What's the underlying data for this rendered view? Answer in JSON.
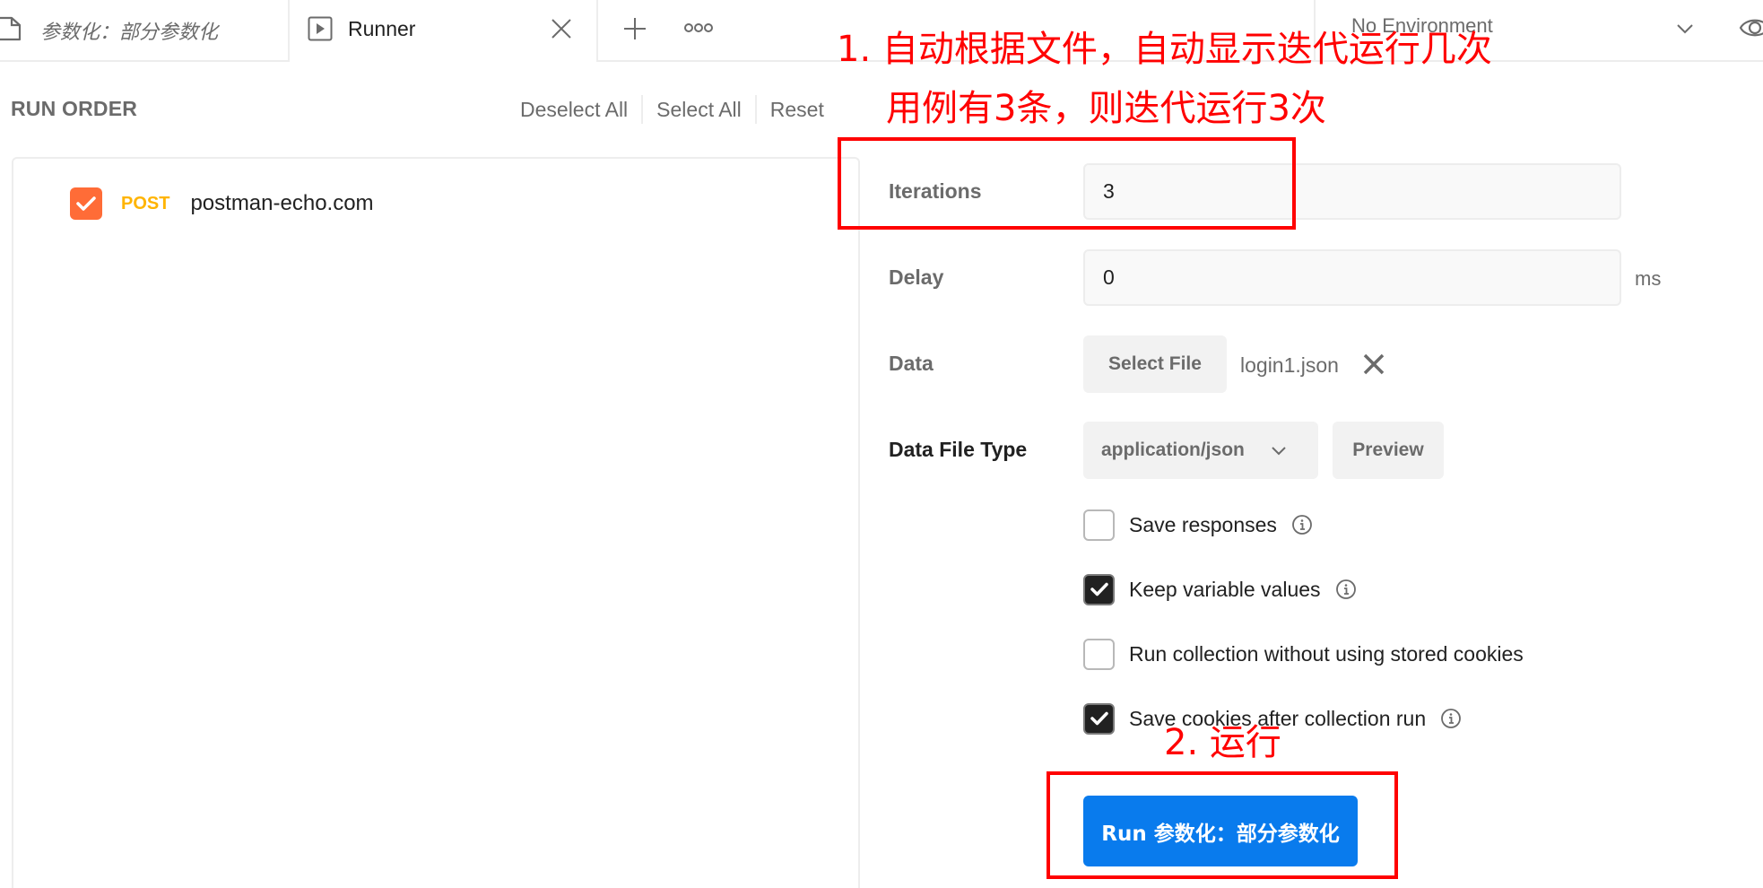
{
  "tabs": [
    {
      "label": "参数化：部分参数化",
      "icon": "collection-doc-icon",
      "active": false
    },
    {
      "label": "Runner",
      "icon": "runner-play-icon",
      "active": true
    }
  ],
  "tab_actions": {
    "new_tab_icon": "plus-icon",
    "more_icon": "more-options-icon"
  },
  "environment": {
    "selected": "No Environment",
    "chevron_icon": "chevron-down-icon",
    "quick_look_icon": "eye-icon"
  },
  "run_order": {
    "title": "RUN ORDER",
    "actions": [
      "Deselect All",
      "Select All",
      "Reset"
    ],
    "items": [
      {
        "method": "POST",
        "name": "postman-echo.com",
        "checked": true
      }
    ]
  },
  "config": {
    "iterations": {
      "label": "Iterations",
      "value": "3"
    },
    "delay": {
      "label": "Delay",
      "value": "0",
      "unit": "ms"
    },
    "data": {
      "label": "Data",
      "button": "Select File",
      "file_name": "login1.json"
    },
    "data_file_type": {
      "label": "Data File Type",
      "selected": "application/json",
      "preview_button": "Preview"
    },
    "options": [
      {
        "label": "Save responses",
        "checked": false,
        "info": true
      },
      {
        "label": "Keep variable values",
        "checked": true,
        "info": true
      },
      {
        "label": "Run collection without using stored cookies",
        "checked": false,
        "info": false
      },
      {
        "label": "Save cookies after collection run",
        "checked": true,
        "info": true
      }
    ],
    "run_button": "Run 参数化：部分参数化"
  },
  "annotations": {
    "note1_line1": "1. 自动根据文件，自动显示迭代运行几次",
    "note1_line2": "用例有3条，则迭代运行3次",
    "note2": "2. 运行",
    "color": "#ff0000"
  },
  "colors": {
    "accent_blue": "#097bed",
    "postman_orange": "#ff6c37",
    "method_post": "#ffb400"
  }
}
